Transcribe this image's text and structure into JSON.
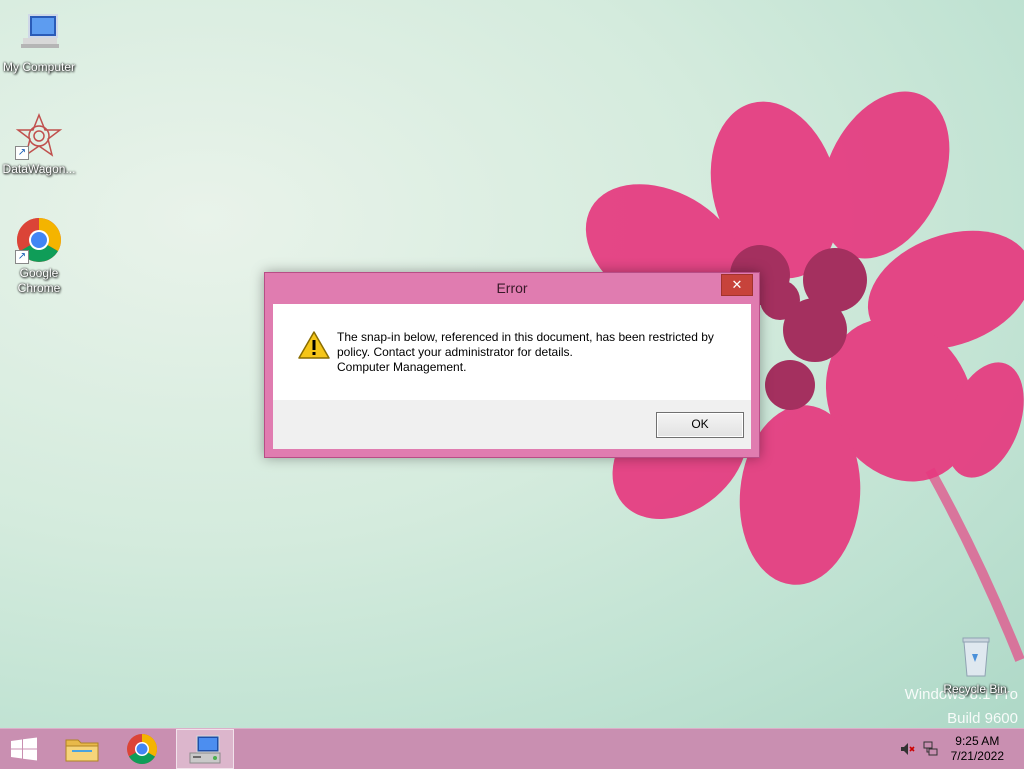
{
  "desktop": {
    "icons": [
      {
        "label": "My Computer",
        "icon": "computer-icon"
      },
      {
        "label": "DataWagon...",
        "icon": "datawagon-icon"
      },
      {
        "label": "Google Chrome",
        "icon": "chrome-icon"
      },
      {
        "label": "Recycle Bin",
        "icon": "recycle-bin-icon"
      }
    ],
    "watermark_line1": "Windows 8.1 Pro",
    "watermark_line2": "Build 9600"
  },
  "dialog": {
    "title": "Error",
    "close_glyph": "✕",
    "message_lines": [
      "The snap-in below, referenced in this document, has been restricted by",
      "policy. Contact your administrator for details.",
      "Computer Management."
    ],
    "ok_label": "OK",
    "icon": "warning-icon"
  },
  "taskbar": {
    "apps": [
      {
        "name": "file-explorer",
        "icon": "folder-icon"
      },
      {
        "name": "google-chrome",
        "icon": "chrome-icon"
      },
      {
        "name": "computer-management",
        "icon": "computer-management-icon",
        "active": true
      }
    ],
    "tray": {
      "volume_icon": "volume-muted-icon",
      "network_icon": "network-icon",
      "time": "9:25 AM",
      "date": "7/21/2022"
    }
  },
  "colors": {
    "dialog_frame": "#e07cb0",
    "taskbar": "#c98fb1",
    "close_button": "#c7433b"
  }
}
